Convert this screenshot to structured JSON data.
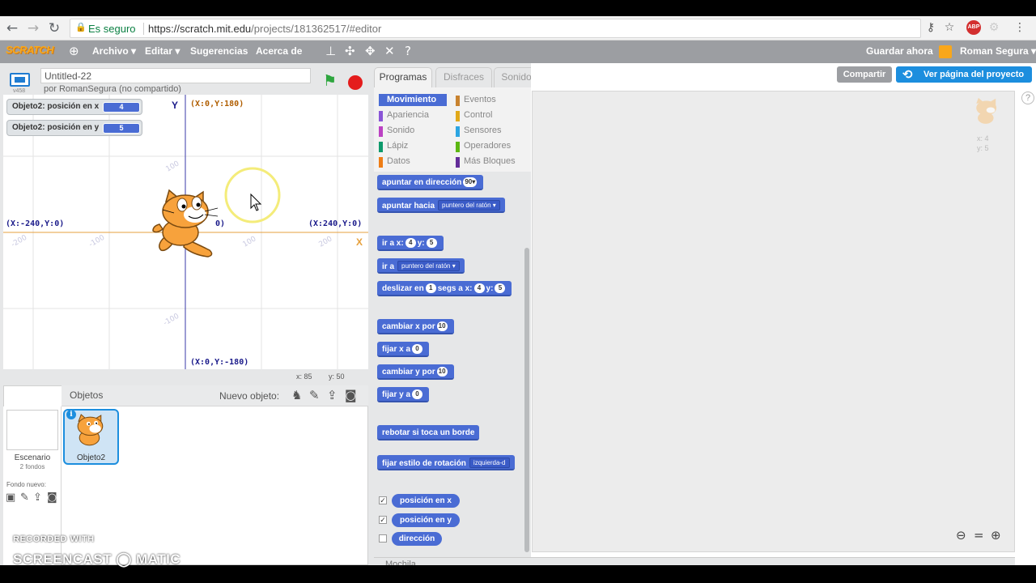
{
  "browser": {
    "secure_label": "Es seguro",
    "url_domain": "https://scratch.mit.edu",
    "url_path": "/projects/181362517/#editor",
    "abp_badge": "ABP"
  },
  "menubar": {
    "logo": "SCRATCH",
    "items": [
      "Archivo ▾",
      "Editar ▾",
      "Sugerencias",
      "Acerca de"
    ],
    "save_now": "Guardar ahora",
    "user": "Roman Segura ▾"
  },
  "project": {
    "title": "Untitled-22",
    "byline": "por RomanSegura (no compartido)",
    "version": "v458"
  },
  "monitors": [
    {
      "label": "Objeto2: posición en x",
      "value": "4"
    },
    {
      "label": "Objeto2: posición en y",
      "value": "5"
    }
  ],
  "stage_labels": {
    "y_axis": "Y",
    "x_axis": "X",
    "top": "(X:0,Y:180)",
    "bottom": "(X:0,Y:-180)",
    "left": "(X:-240,Y:0)",
    "right": "(X:240,Y:0)",
    "center_fragment": "0)",
    "ticks_x": [
      "-200",
      "-100",
      "100",
      "200"
    ],
    "ticks_y": [
      "100",
      "-100"
    ]
  },
  "mouse": {
    "x_label": "x:",
    "x": "85",
    "y_label": "y:",
    "y": "50"
  },
  "sprites": {
    "title": "Objetos",
    "new_object": "Nuevo objeto:",
    "stage_name": "Escenario",
    "stage_backdrops": "2 fondos",
    "new_backdrop": "Fondo nuevo:",
    "sprite_name": "Objeto2",
    "info": "i"
  },
  "tabs": [
    "Programas",
    "Disfraces",
    "Sonidos"
  ],
  "categories": [
    {
      "label": "Movimiento",
      "color": "#4a6cd4"
    },
    {
      "label": "Apariencia",
      "color": "#8a55d7"
    },
    {
      "label": "Sonido",
      "color": "#bb42c3"
    },
    {
      "label": "Lápiz",
      "color": "#0e9a6c"
    },
    {
      "label": "Datos",
      "color": "#ee7d16"
    },
    {
      "label": "Eventos",
      "color": "#c88330"
    },
    {
      "label": "Control",
      "color": "#e1a91a"
    },
    {
      "label": "Sensores",
      "color": "#2ca5e2"
    },
    {
      "label": "Operadores",
      "color": "#5cb712"
    },
    {
      "label": "Más Bloques",
      "color": "#632d99"
    }
  ],
  "blocks": {
    "point_dir": "apuntar en dirección",
    "point_dir_val": "90▾",
    "point_towards": "apuntar hacia",
    "point_towards_val": "puntero del ratón ▾",
    "goto_xy": "ir a x:",
    "goto_x": "4",
    "y_lbl": "y:",
    "goto_y": "5",
    "goto": "ir a",
    "goto_val": "puntero del ratón ▾",
    "glide": "deslizar en",
    "glide_secs": "1",
    "glide_mid": "segs a x:",
    "glide_x": "4",
    "glide_y": "5",
    "change_x": "cambiar x por",
    "change_x_val": "10",
    "set_x": "fijar x a",
    "set_x_val": "0",
    "change_y": "cambiar y por",
    "change_y_val": "10",
    "set_y": "fijar y a",
    "set_y_val": "0",
    "bounce": "rebotar si toca un borde",
    "rot_style": "fijar estilo de rotación",
    "rot_style_val": "izquierda-d",
    "rep_x": "posición en x",
    "rep_y": "posición en y",
    "rep_dir": "dirección"
  },
  "right": {
    "share": "Compartir",
    "view_page": "Ver página del proyecto",
    "help": "?",
    "ghost_x": "x: 4",
    "ghost_y": "y: 5"
  },
  "backpack": "Mochila",
  "watermark": {
    "line1": "RECORDED WITH",
    "line2": "SCREENCAST ◯ MATIC"
  }
}
